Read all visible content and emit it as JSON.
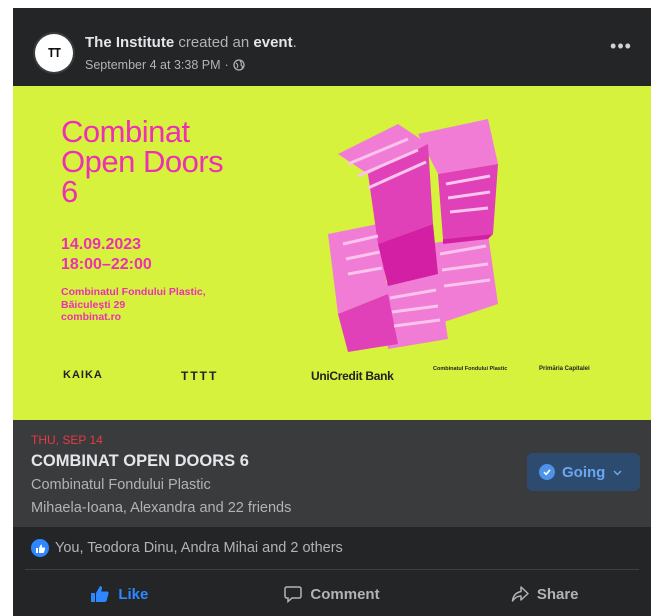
{
  "post": {
    "author": "The Institute",
    "action_text": "created an",
    "object_text": "event",
    "period": ".",
    "timestamp": "September 4 at 3:38 PM",
    "separator": "·",
    "privacy_icon": "globe-icon",
    "more_label": "•••",
    "avatar_mark": "TT"
  },
  "poster": {
    "title_lines": [
      "Combinat",
      "Open Doors",
      "6"
    ],
    "date": "14.09.2023",
    "time": "18:00–22:00",
    "venue": "Combinatul Fondului Plastic, Băiculești 29",
    "website": "combinat.ro",
    "accent_color": "#ec2fb4",
    "background_color": "#d6f23d",
    "sponsors": [
      "KAIKA",
      "TTTT",
      "UniCredit Bank",
      "Combinatul Fondului Plastic",
      "Primăria Capitalei"
    ]
  },
  "event": {
    "date_label": "THU, SEP 14",
    "title": "COMBINAT OPEN DOORS 6",
    "location": "Combinatul Fondului Plastic",
    "friends": "Mihaela-Ioana, Alexandra and 22 friends",
    "going_label": "Going",
    "date_color": "#e63a45"
  },
  "reactions": {
    "text": "You, Teodora Dinu, Andra Mihai and 2 others",
    "icon": "like-icon"
  },
  "actions": {
    "like": "Like",
    "comment": "Comment",
    "share": "Share",
    "like_color": "#2d88ff"
  }
}
